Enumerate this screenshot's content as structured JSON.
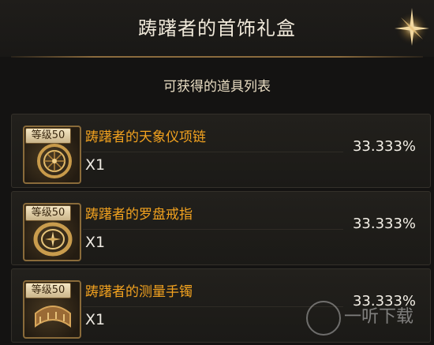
{
  "header": {
    "title": "踌躇者的首饰礼盒"
  },
  "list": {
    "heading": "可获得的道具列表",
    "items": [
      {
        "level": "等级50",
        "name": "踌躇者的天象仪项链",
        "qty": "X1",
        "probability": "33.333%",
        "icon": "necklace-icon"
      },
      {
        "level": "等级50",
        "name": "踌躇者的罗盘戒指",
        "qty": "X1",
        "probability": "33.333%",
        "icon": "ring-icon"
      },
      {
        "level": "等级50",
        "name": "踌躇者的测量手镯",
        "qty": "X1",
        "probability": "33.333%",
        "icon": "bracelet-icon"
      }
    ]
  },
  "watermark": {
    "text": "一听下载"
  },
  "colors": {
    "accent": "#f2a21f",
    "border": "#8a6b3a",
    "background": "#141312"
  }
}
